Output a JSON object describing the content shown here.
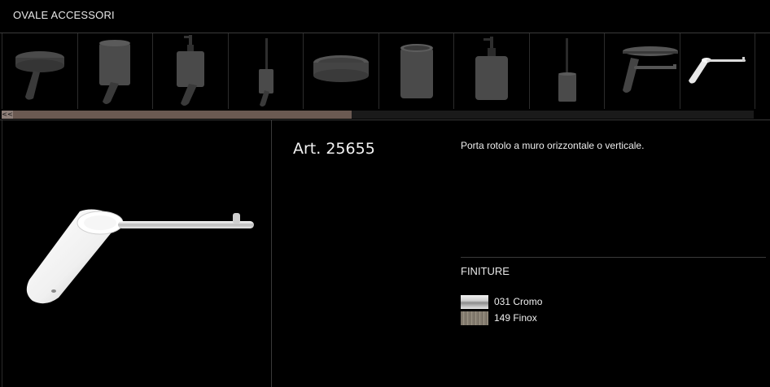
{
  "header": {
    "title": "OVALE ACCESSORI"
  },
  "thumbnails": [
    {
      "icon": "soap-dish-icon"
    },
    {
      "icon": "tumbler-holder-icon"
    },
    {
      "icon": "soap-dispenser-icon"
    },
    {
      "icon": "toilet-brush-icon"
    },
    {
      "icon": "soap-dish-standing-icon"
    },
    {
      "icon": "tumbler-standing-icon"
    },
    {
      "icon": "soap-dispenser-standing-icon"
    },
    {
      "icon": "toilet-brush-standing-icon"
    },
    {
      "icon": "shelf-holder-icon"
    },
    {
      "icon": "paper-holder-icon"
    }
  ],
  "scrollbar": {
    "left_button": "<<",
    "position": 0.45
  },
  "product": {
    "article": "Art. 25655",
    "description": "Porta rotolo a muro orizzontale o verticale."
  },
  "finishes": {
    "label": "FINITURE",
    "items": [
      {
        "label": "031 Cromo",
        "color": "#d8d8d8"
      },
      {
        "label": "149 Finox",
        "color": "#857d70"
      }
    ]
  }
}
